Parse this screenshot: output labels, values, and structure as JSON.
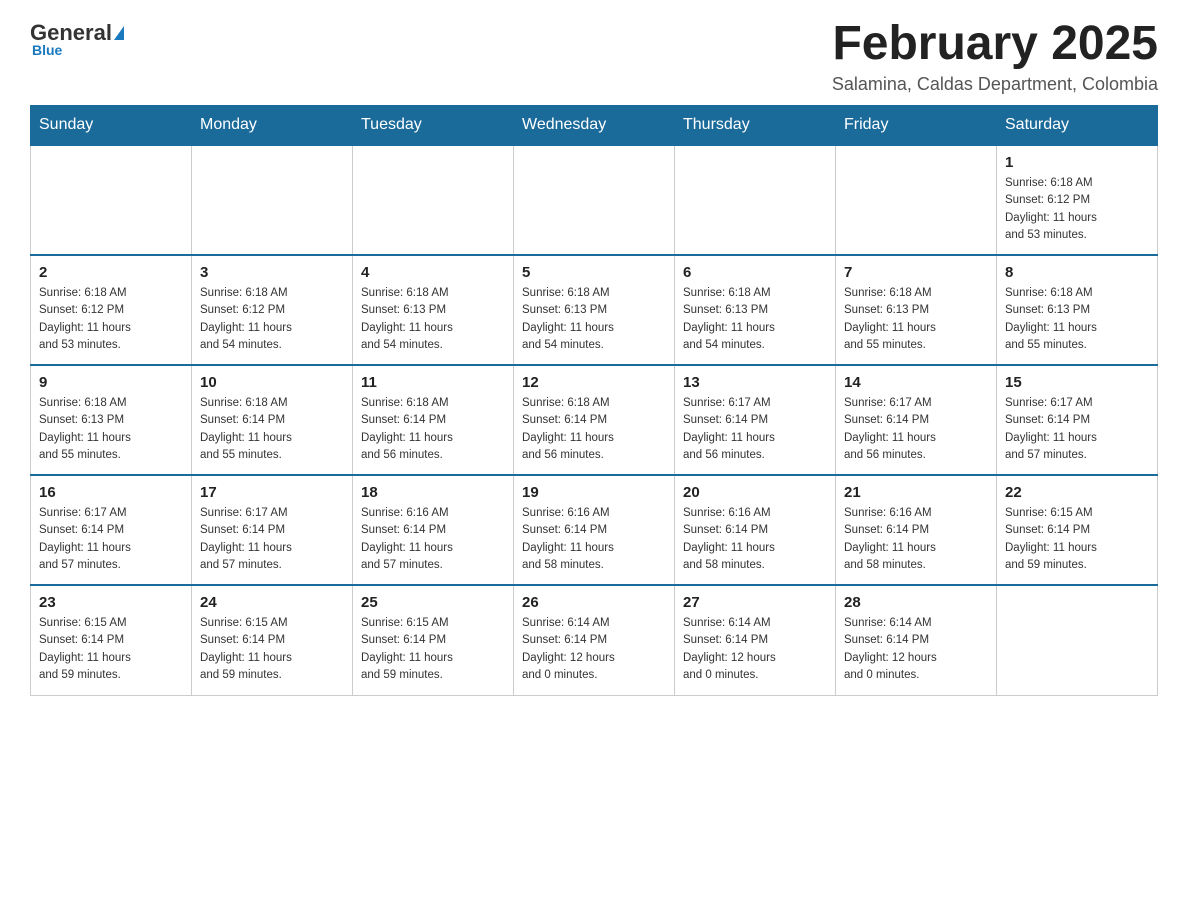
{
  "header": {
    "logo_main": "General",
    "logo_sub": "Blue",
    "month_title": "February 2025",
    "subtitle": "Salamina, Caldas Department, Colombia"
  },
  "weekdays": [
    "Sunday",
    "Monday",
    "Tuesday",
    "Wednesday",
    "Thursday",
    "Friday",
    "Saturday"
  ],
  "weeks": [
    {
      "days": [
        {
          "number": "",
          "info": "",
          "empty": true
        },
        {
          "number": "",
          "info": "",
          "empty": true
        },
        {
          "number": "",
          "info": "",
          "empty": true
        },
        {
          "number": "",
          "info": "",
          "empty": true
        },
        {
          "number": "",
          "info": "",
          "empty": true
        },
        {
          "number": "",
          "info": "",
          "empty": true
        },
        {
          "number": "1",
          "info": "Sunrise: 6:18 AM\nSunset: 6:12 PM\nDaylight: 11 hours\nand 53 minutes.",
          "empty": false
        }
      ]
    },
    {
      "days": [
        {
          "number": "2",
          "info": "Sunrise: 6:18 AM\nSunset: 6:12 PM\nDaylight: 11 hours\nand 53 minutes.",
          "empty": false
        },
        {
          "number": "3",
          "info": "Sunrise: 6:18 AM\nSunset: 6:12 PM\nDaylight: 11 hours\nand 54 minutes.",
          "empty": false
        },
        {
          "number": "4",
          "info": "Sunrise: 6:18 AM\nSunset: 6:13 PM\nDaylight: 11 hours\nand 54 minutes.",
          "empty": false
        },
        {
          "number": "5",
          "info": "Sunrise: 6:18 AM\nSunset: 6:13 PM\nDaylight: 11 hours\nand 54 minutes.",
          "empty": false
        },
        {
          "number": "6",
          "info": "Sunrise: 6:18 AM\nSunset: 6:13 PM\nDaylight: 11 hours\nand 54 minutes.",
          "empty": false
        },
        {
          "number": "7",
          "info": "Sunrise: 6:18 AM\nSunset: 6:13 PM\nDaylight: 11 hours\nand 55 minutes.",
          "empty": false
        },
        {
          "number": "8",
          "info": "Sunrise: 6:18 AM\nSunset: 6:13 PM\nDaylight: 11 hours\nand 55 minutes.",
          "empty": false
        }
      ]
    },
    {
      "days": [
        {
          "number": "9",
          "info": "Sunrise: 6:18 AM\nSunset: 6:13 PM\nDaylight: 11 hours\nand 55 minutes.",
          "empty": false
        },
        {
          "number": "10",
          "info": "Sunrise: 6:18 AM\nSunset: 6:14 PM\nDaylight: 11 hours\nand 55 minutes.",
          "empty": false
        },
        {
          "number": "11",
          "info": "Sunrise: 6:18 AM\nSunset: 6:14 PM\nDaylight: 11 hours\nand 56 minutes.",
          "empty": false
        },
        {
          "number": "12",
          "info": "Sunrise: 6:18 AM\nSunset: 6:14 PM\nDaylight: 11 hours\nand 56 minutes.",
          "empty": false
        },
        {
          "number": "13",
          "info": "Sunrise: 6:17 AM\nSunset: 6:14 PM\nDaylight: 11 hours\nand 56 minutes.",
          "empty": false
        },
        {
          "number": "14",
          "info": "Sunrise: 6:17 AM\nSunset: 6:14 PM\nDaylight: 11 hours\nand 56 minutes.",
          "empty": false
        },
        {
          "number": "15",
          "info": "Sunrise: 6:17 AM\nSunset: 6:14 PM\nDaylight: 11 hours\nand 57 minutes.",
          "empty": false
        }
      ]
    },
    {
      "days": [
        {
          "number": "16",
          "info": "Sunrise: 6:17 AM\nSunset: 6:14 PM\nDaylight: 11 hours\nand 57 minutes.",
          "empty": false
        },
        {
          "number": "17",
          "info": "Sunrise: 6:17 AM\nSunset: 6:14 PM\nDaylight: 11 hours\nand 57 minutes.",
          "empty": false
        },
        {
          "number": "18",
          "info": "Sunrise: 6:16 AM\nSunset: 6:14 PM\nDaylight: 11 hours\nand 57 minutes.",
          "empty": false
        },
        {
          "number": "19",
          "info": "Sunrise: 6:16 AM\nSunset: 6:14 PM\nDaylight: 11 hours\nand 58 minutes.",
          "empty": false
        },
        {
          "number": "20",
          "info": "Sunrise: 6:16 AM\nSunset: 6:14 PM\nDaylight: 11 hours\nand 58 minutes.",
          "empty": false
        },
        {
          "number": "21",
          "info": "Sunrise: 6:16 AM\nSunset: 6:14 PM\nDaylight: 11 hours\nand 58 minutes.",
          "empty": false
        },
        {
          "number": "22",
          "info": "Sunrise: 6:15 AM\nSunset: 6:14 PM\nDaylight: 11 hours\nand 59 minutes.",
          "empty": false
        }
      ]
    },
    {
      "days": [
        {
          "number": "23",
          "info": "Sunrise: 6:15 AM\nSunset: 6:14 PM\nDaylight: 11 hours\nand 59 minutes.",
          "empty": false
        },
        {
          "number": "24",
          "info": "Sunrise: 6:15 AM\nSunset: 6:14 PM\nDaylight: 11 hours\nand 59 minutes.",
          "empty": false
        },
        {
          "number": "25",
          "info": "Sunrise: 6:15 AM\nSunset: 6:14 PM\nDaylight: 11 hours\nand 59 minutes.",
          "empty": false
        },
        {
          "number": "26",
          "info": "Sunrise: 6:14 AM\nSunset: 6:14 PM\nDaylight: 12 hours\nand 0 minutes.",
          "empty": false
        },
        {
          "number": "27",
          "info": "Sunrise: 6:14 AM\nSunset: 6:14 PM\nDaylight: 12 hours\nand 0 minutes.",
          "empty": false
        },
        {
          "number": "28",
          "info": "Sunrise: 6:14 AM\nSunset: 6:14 PM\nDaylight: 12 hours\nand 0 minutes.",
          "empty": false
        },
        {
          "number": "",
          "info": "",
          "empty": true
        }
      ]
    }
  ]
}
